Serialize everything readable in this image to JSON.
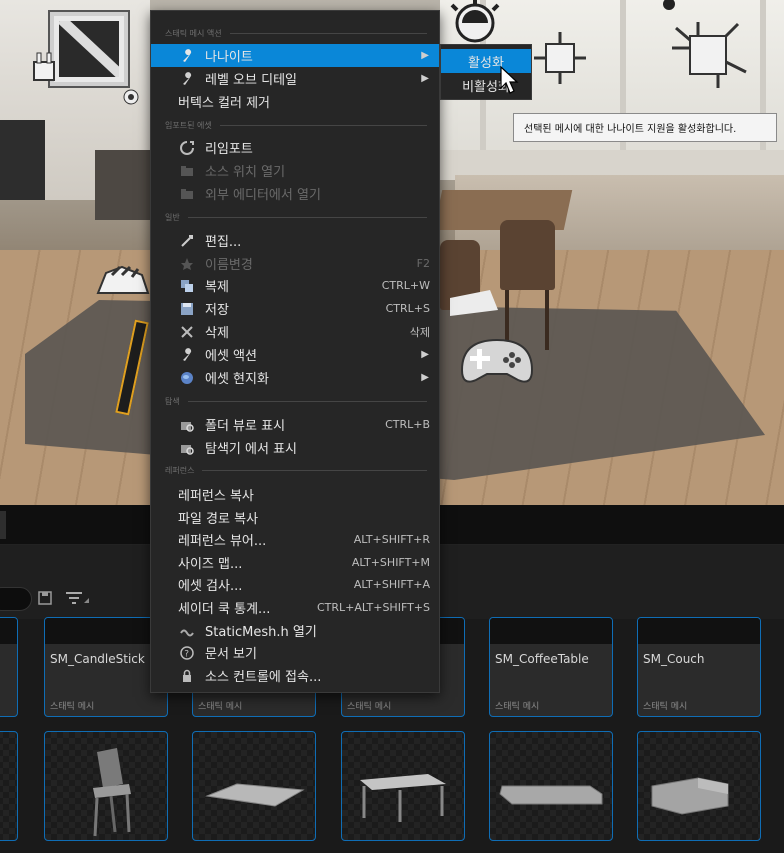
{
  "context_menu": {
    "sections": {
      "static_mesh_actions": "스태틱 메시 액션",
      "imported_asset": "임포트된 에셋",
      "general": "일반",
      "explore": "탐색",
      "references": "레퍼런스"
    },
    "items": {
      "nanite": "나나이트",
      "lod": "레벨 오브 디테일",
      "remove_vertex_colors": "버텍스 컬러 제거",
      "reimport": "리임포트",
      "open_source_location": "소스 위치 열기",
      "open_in_external_editor": "외부 에디터에서 열기",
      "edit": "편집...",
      "rename": "이름변경",
      "rename_shortcut": "F2",
      "duplicate": "복제",
      "duplicate_shortcut": "CTRL+W",
      "save": "저장",
      "save_shortcut": "CTRL+S",
      "delete": "삭제",
      "delete_shortcut": "삭제",
      "asset_actions": "에셋 액션",
      "asset_localization": "에셋 현지화",
      "show_in_folder_view": "폴더 뷰로 표시",
      "show_in_folder_view_shortcut": "CTRL+B",
      "show_in_explorer": "탐색기 에서 표시",
      "copy_reference": "레퍼런스 복사",
      "copy_file_path": "파일 경로 복사",
      "reference_viewer": "레퍼런스 뷰어...",
      "reference_viewer_shortcut": "ALT+SHIFT+R",
      "size_map": "사이즈 맵...",
      "size_map_shortcut": "ALT+SHIFT+M",
      "audit_assets": "에셋 검사...",
      "audit_assets_shortcut": "ALT+SHIFT+A",
      "shader_cook_stats": "세이더 쿡 통계...",
      "shader_cook_stats_shortcut": "CTRL+ALT+SHIFT+S",
      "open_header": "StaticMesh.h 열기",
      "view_docs": "문서 보기",
      "connect_source_control": "소스 컨트롤에 접속..."
    }
  },
  "submenu": {
    "enable": "활성화",
    "disable": "비활성화"
  },
  "tooltip": "선택된 메시에 대한 나나이트 지원을 활성화합니다.",
  "content_browser": {
    "assets_row1": [
      {
        "name": "SM_CandleStick",
        "type": "스태틱 메시"
      },
      {
        "name": "",
        "type": "스태틱 메시"
      },
      {
        "name": "",
        "type": "스태틱 메시"
      },
      {
        "name": "SM_CoffeeTable",
        "type": "스태틱 메시"
      },
      {
        "name": "SM_Couch",
        "type": "스태틱 메시"
      }
    ]
  },
  "colors": {
    "highlight": "#0a87d8",
    "menu_bg": "#262626",
    "tile_border": "#0f6db5"
  }
}
